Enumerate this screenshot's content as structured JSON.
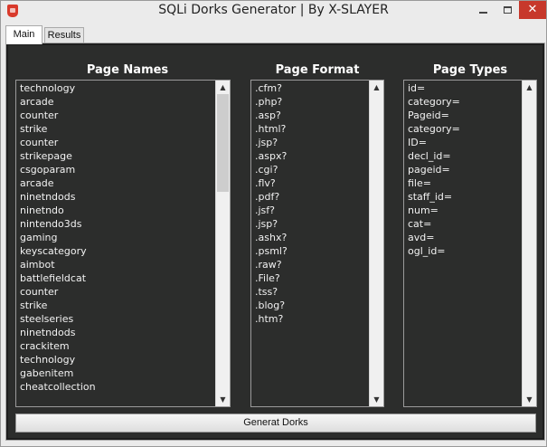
{
  "window": {
    "title": "SQLi Dorks Generator | By X-SLAYER",
    "close_glyph": "✕"
  },
  "tabs": [
    {
      "label": "Main",
      "active": true
    },
    {
      "label": "Results",
      "active": false
    }
  ],
  "columns": {
    "page_names": {
      "title": "Page Names",
      "items": [
        "technology",
        "arcade",
        "counter",
        "strike",
        "counter",
        "strikepage",
        "csgoparam",
        "arcade",
        "ninetndods",
        "ninetndo",
        "nintendo3ds",
        "gaming",
        "keyscategory",
        "aimbot",
        "battlefieldcat",
        "counter",
        "strike",
        "steelseries",
        "ninetndods",
        "crackitem",
        "technology",
        "gabenitem",
        "cheatcollection"
      ]
    },
    "page_format": {
      "title": "Page Format",
      "items": [
        ".cfm?",
        ".php?",
        ".asp?",
        ".html?",
        ".jsp?",
        ".aspx?",
        ".cgi?",
        ".flv?",
        ".pdf?",
        ".jsf?",
        ".jsp?",
        ".ashx?",
        ".psml?",
        ".raw?",
        ".File?",
        ".tss?",
        ".blog?",
        ".htm?"
      ]
    },
    "page_types": {
      "title": "Page Types",
      "items": [
        "id=",
        "category=",
        "Pageid=",
        "category=",
        "ID=",
        "decl_id=",
        "pageid=",
        "file=",
        "staff_id=",
        "num=",
        "cat=",
        "avd=",
        "ogl_id="
      ]
    }
  },
  "scroll": {
    "up_glyph": "▲",
    "down_glyph": "▼"
  },
  "actions": {
    "generate_label": "Generat Dorks"
  },
  "colors": {
    "panel_bg": "#2c2d2c",
    "text": "#f2f2f2",
    "close_button": "#c7382b"
  }
}
